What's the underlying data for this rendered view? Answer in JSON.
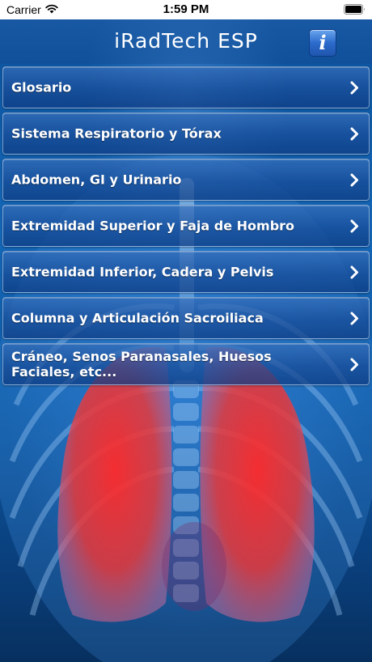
{
  "status_bar": {
    "carrier": "Carrier",
    "time": "1:59 PM",
    "wifi_icon": "wifi-icon",
    "battery_icon": "battery-full-icon"
  },
  "nav": {
    "title": "iRadTech ESP",
    "info_button_label": "i"
  },
  "menu": {
    "items": [
      {
        "label": "Glosario"
      },
      {
        "label": "Sistema Respiratorio y Tórax"
      },
      {
        "label": "Abdomen, GI y Urinario"
      },
      {
        "label": "Extremidad Superior y Faja de Hombro"
      },
      {
        "label": "Extremidad Inferior, Cadera y Pelvis"
      },
      {
        "label": "Columna y Articulación Sacroiliaca"
      },
      {
        "label": "Cráneo, Senos Paranasales, Huesos Faciales, etc..."
      }
    ],
    "chevron_icon": "chevron-right-icon"
  },
  "background": {
    "image": "lungs-xray-illustration",
    "colors": {
      "bg_blue": "#1467b8",
      "lung_red": "#e8383a"
    }
  }
}
